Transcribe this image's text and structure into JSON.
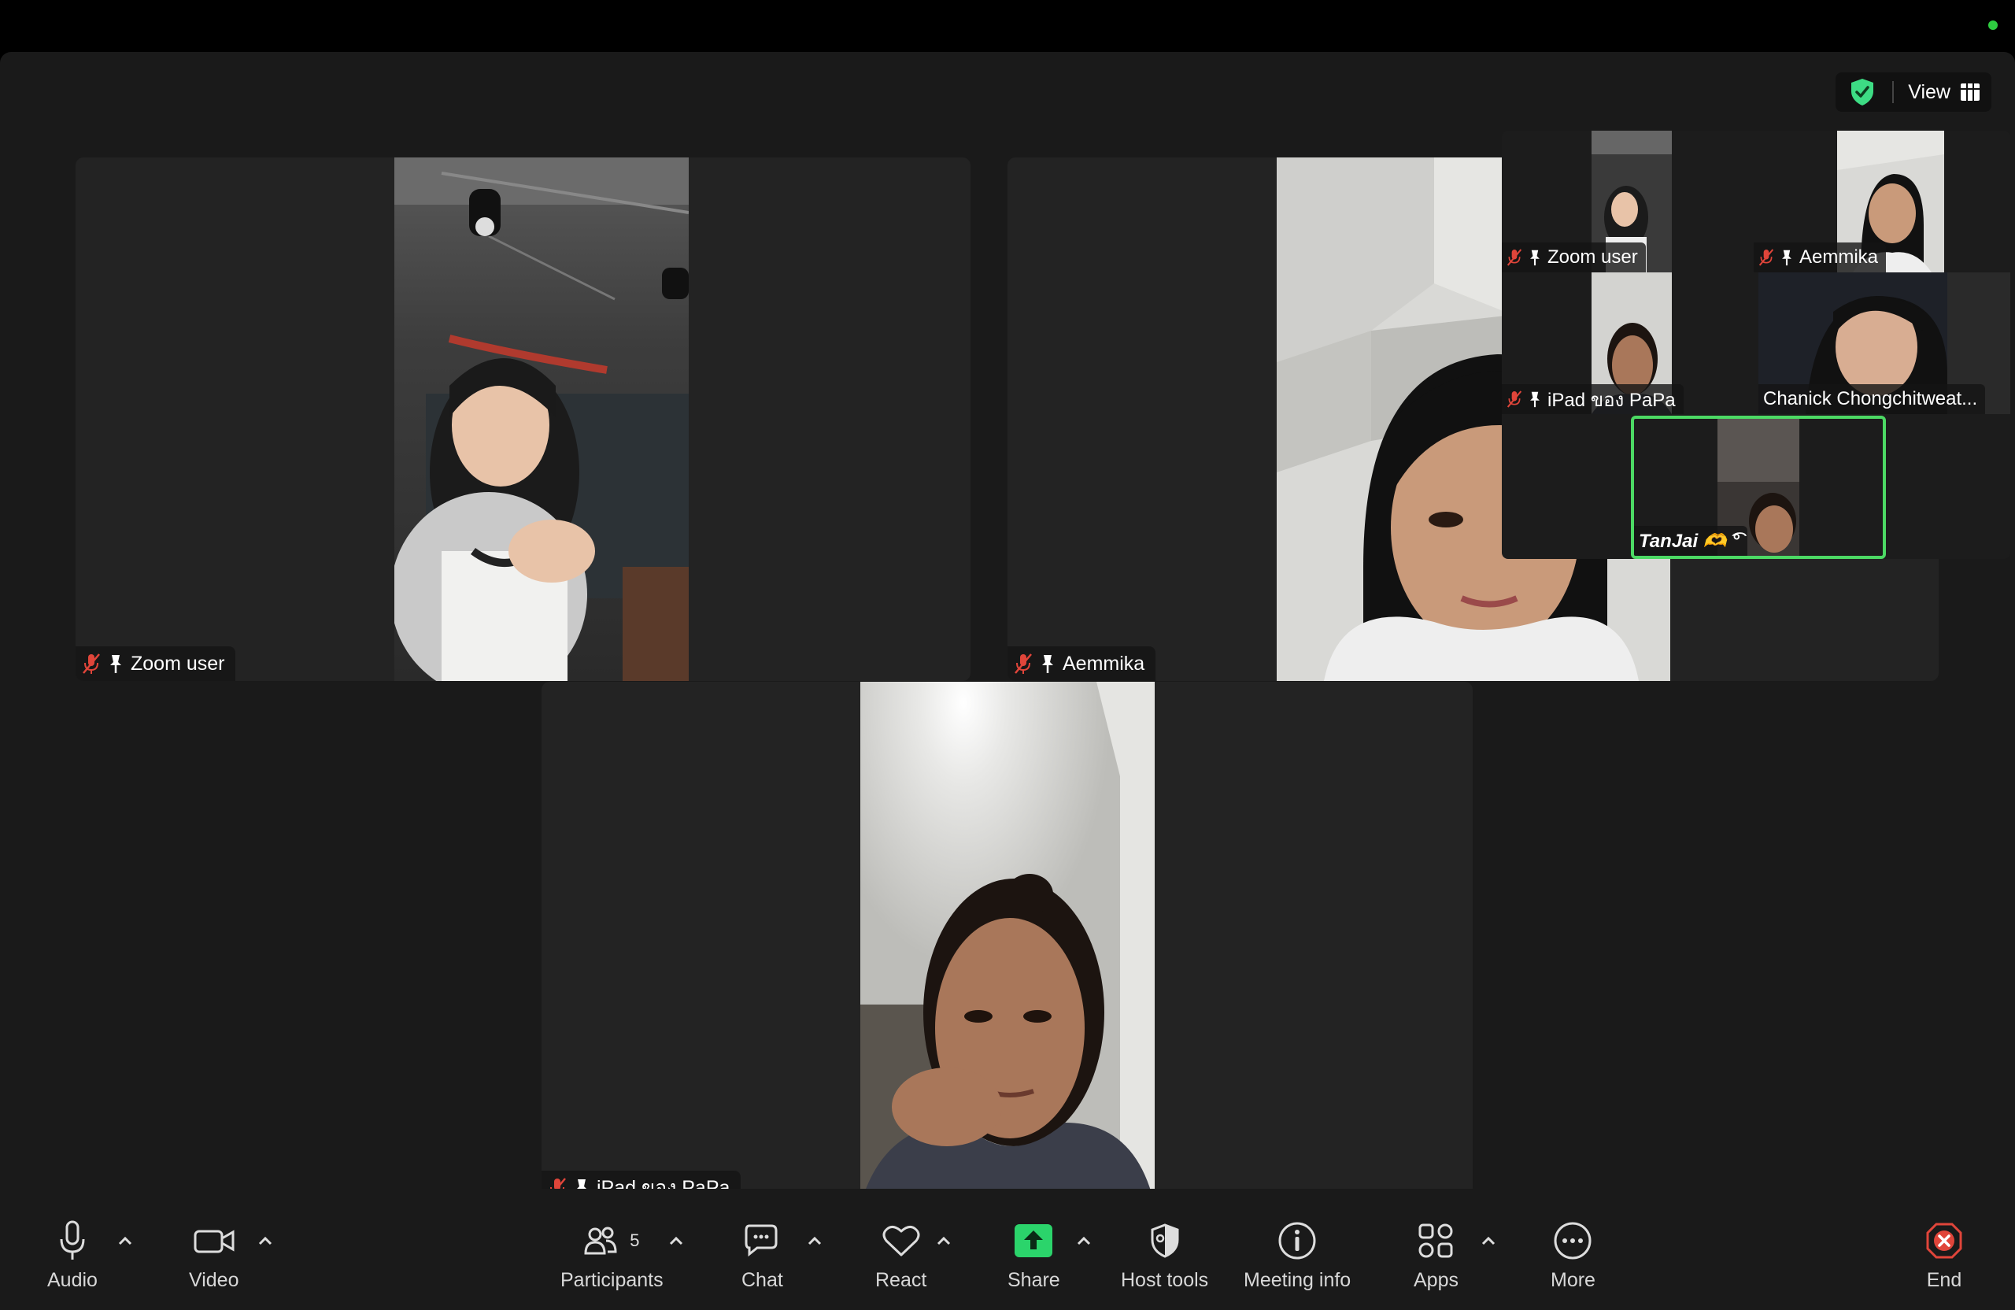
{
  "view_button": {
    "label": "View"
  },
  "tiles": {
    "zoom_user": {
      "name": "Zoom user"
    },
    "aemmika": {
      "name": "Aemmika"
    },
    "ipad_papa": {
      "name": "iPad ของ PaPa"
    }
  },
  "thumbnails": [
    {
      "name": "Zoom user"
    },
    {
      "name": "Aemmika"
    },
    {
      "name": "iPad ของ PaPa"
    },
    {
      "name": "Chanick Chongchitweat..."
    },
    {
      "name": "TanJai 🫶 ͡°"
    }
  ],
  "toolbar": {
    "audio": "Audio",
    "video": "Video",
    "participants": "Participants",
    "participants_count": "5",
    "chat": "Chat",
    "react": "React",
    "share": "Share",
    "host_tools": "Host tools",
    "meeting_info": "Meeting info",
    "apps": "Apps",
    "more": "More",
    "end": "End"
  },
  "colors": {
    "accent_green": "#4cd964",
    "share_green": "#2bd46b",
    "end_red": "#e0453a",
    "muted_red": "#e0453a"
  }
}
